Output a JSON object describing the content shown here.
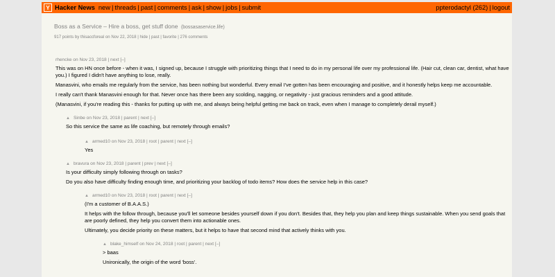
{
  "nav": {
    "logo": "Y",
    "site_name": "Hacker News",
    "links": [
      "new",
      "threads",
      "past",
      "comments",
      "ask",
      "show",
      "jobs",
      "submit"
    ],
    "user": "ppterodactyl (262)",
    "logout": "logout",
    "sep": "|"
  },
  "story": {
    "title": "Boss as a Service – Hire a boss, get stuff done",
    "domain": "(bossasaservice.life)",
    "meta": "917 points by thisaccforeal on Nov 22, 2018 | hide | past | favorite | 276 comments"
  },
  "comments": [
    {
      "head": "rhencke on Nov 23, 2018 | next [–]",
      "paragraphs": [
        "This was on HN once before - when it was, I signed up, because I struggle with prioritizing things that I need to do in my personal life over my professional life. (Hair cut, clean car, dentist, what have you.) I figured I didn't have anything to lose, really.",
        "Manasvini, who emails me regularly from the service, has been nothing but wonderful. Every email I've gotten has been encouraging and positive, and it honestly helps keep me accountable.",
        "I really can't thank Manasvini enough for that. Never once has there been any scolding, nagging, or negativity - just gracious reminders and a good attitude.",
        "(Manasvini, if you're reading this - thanks for putting up with me, and always being helpful getting me back on track, even when I manage to completely derail myself.)"
      ]
    },
    {
      "head": "Sinbe on Nov 23, 2018 | parent | next [–]",
      "paragraphs": [
        "So this service the same as life coaching, but remotely through emails?"
      ]
    },
    {
      "head": "armed10 on Nov 23, 2018 | root | parent | next [–]",
      "paragraphs": [
        "Yes"
      ]
    },
    {
      "head": "bravura on Nov 23, 2018 | parent | prev | next [–]",
      "paragraphs": [
        "Is your difficulty simply following through on tasks?",
        "Do you also have difficulty finding enough time, and prioritizing your backlog of todo items? How does the service help in this case?"
      ]
    },
    {
      "head": "armed10 on Nov 23, 2018 | root | parent | next [–]",
      "paragraphs": [
        "(I'm a customer of B.A.A.S.)",
        "It helps with the follow through, because you'll let someone besides yourself down if you don't. Besides that, they help you plan and keep things sustainable. When you send goals that are poorly defined, they help you convert them into actionable ones.",
        "Ultimately, you decide priority on these matters, but it helps to have that second mind that actively thinks with you."
      ]
    },
    {
      "head": "blake_himself on Nov 24, 2018 | root | parent | next [–]",
      "paragraphs": [
        "> baas",
        "Unironically, the origin of the word 'boss'."
      ]
    }
  ]
}
